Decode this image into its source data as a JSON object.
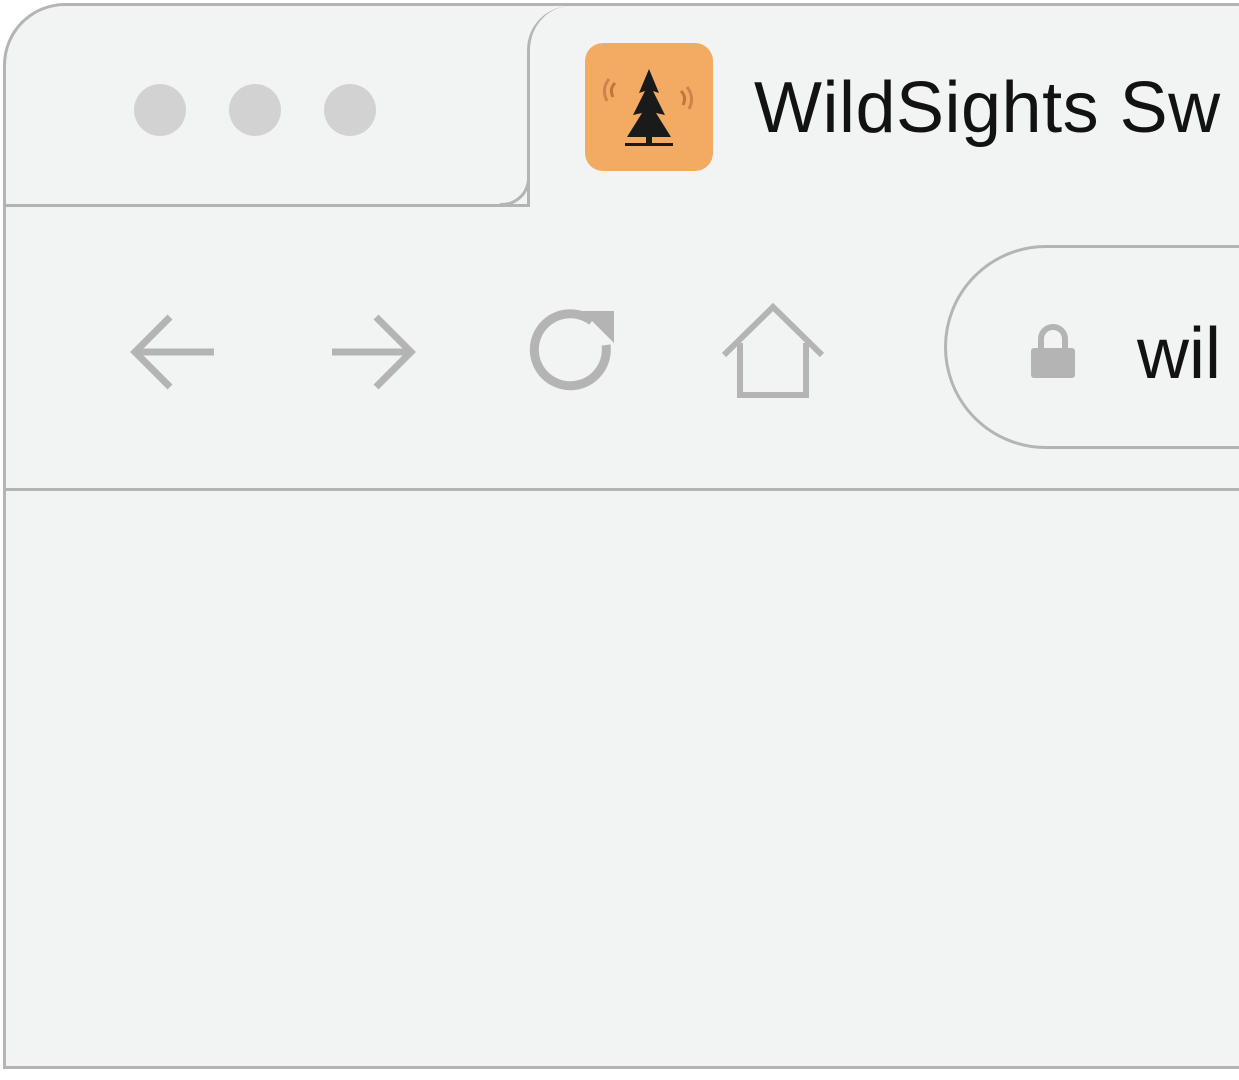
{
  "window": {
    "controls": [
      "close",
      "minimize",
      "maximize"
    ]
  },
  "tab": {
    "title": "WildSights Sw",
    "favicon": "pine-tree-icon",
    "favicon_color": "#f3aa62"
  },
  "toolbar": {
    "back": "back-arrow-icon",
    "forward": "forward-arrow-icon",
    "reload": "reload-icon",
    "home": "home-icon",
    "icon_color": "#b4b4b4"
  },
  "address_bar": {
    "url": "wil",
    "lock": "lock-icon"
  },
  "colors": {
    "chrome_bg": "#f2f4f4",
    "border": "#b4b4b4",
    "dot": "#d2d2d2",
    "text": "#121212"
  }
}
